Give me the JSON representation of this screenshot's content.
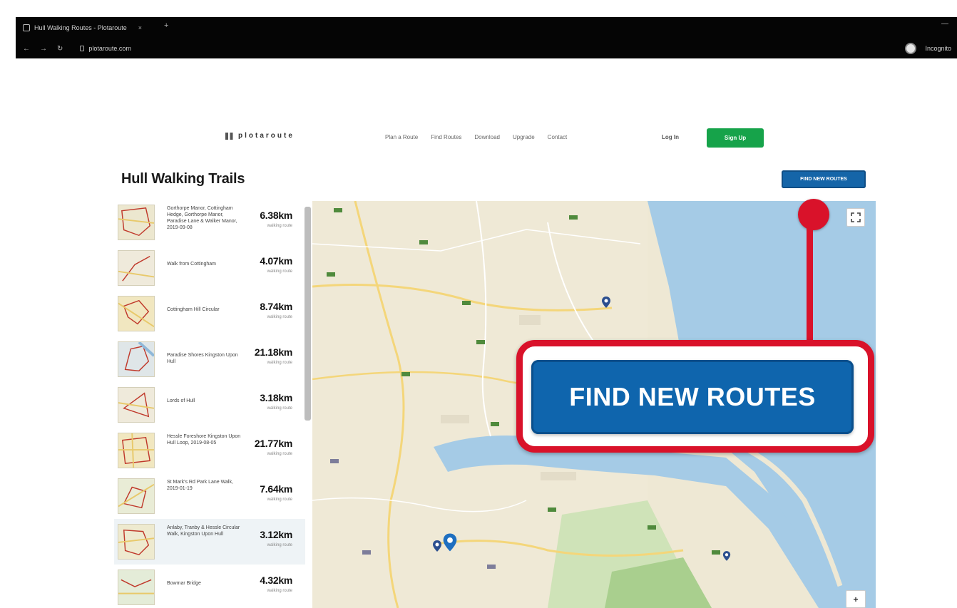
{
  "browser": {
    "tab_title": "Hull Walking Routes - Plotaroute",
    "tab_close": "×",
    "new_tab": "+",
    "window_controls": "—",
    "nav": {
      "back": "←",
      "forward": "→",
      "reload": "↻"
    },
    "url": "plotaroute.com",
    "profile_label": "Incognito"
  },
  "site": {
    "logo_text": "plotaroute",
    "nav_items": [
      "Plan a Route",
      "Find Routes",
      "Download",
      "Upgrade",
      "Contact"
    ],
    "login_label": "Log In",
    "signup_label": "Sign Up"
  },
  "page": {
    "title": "Hull Walking Trails",
    "find_routes_small_label": "FIND NEW ROUTES"
  },
  "routes": [
    {
      "name": "Gorthorpe Manor, Cottingham Hedge, Gorthorpe Manor, Paradise Lane & Walker Manor, 2019-09-08",
      "distance": "6.38km",
      "type": "walking route"
    },
    {
      "name": "Walk from Cottingham",
      "distance": "4.07km",
      "type": "walking route"
    },
    {
      "name": "Cottingham Hill Circular",
      "distance": "8.74km",
      "type": "walking route"
    },
    {
      "name": "Paradise Shores Kingston Upon Hull",
      "distance": "21.18km",
      "type": "walking route"
    },
    {
      "name": "Lords of Hull",
      "distance": "3.18km",
      "type": "walking route"
    },
    {
      "name": "Hessle Foreshore Kingston Upon Hull Loop, 2019-08-05",
      "distance": "21.77km",
      "type": "walking route"
    },
    {
      "name": "St Mark's Rd Park Lane Walk, 2019-01-19",
      "distance": "7.64km",
      "type": "walking route"
    },
    {
      "name": "Anlaby, Tranby & Hessle Circular Walk, Kingston Upon Hull",
      "distance": "3.12km",
      "type": "walking route"
    },
    {
      "name": "Bowmar Bridge",
      "distance": "4.32km",
      "type": "walking route"
    }
  ],
  "map": {
    "zoom_label": "+"
  },
  "callout": {
    "label": "FIND NEW ROUTES",
    "accent_color": "#d9122a",
    "button_color": "#0f65ad"
  },
  "icons": {
    "fullscreen": "fullscreen-icon",
    "pin": "map-pin-icon"
  }
}
